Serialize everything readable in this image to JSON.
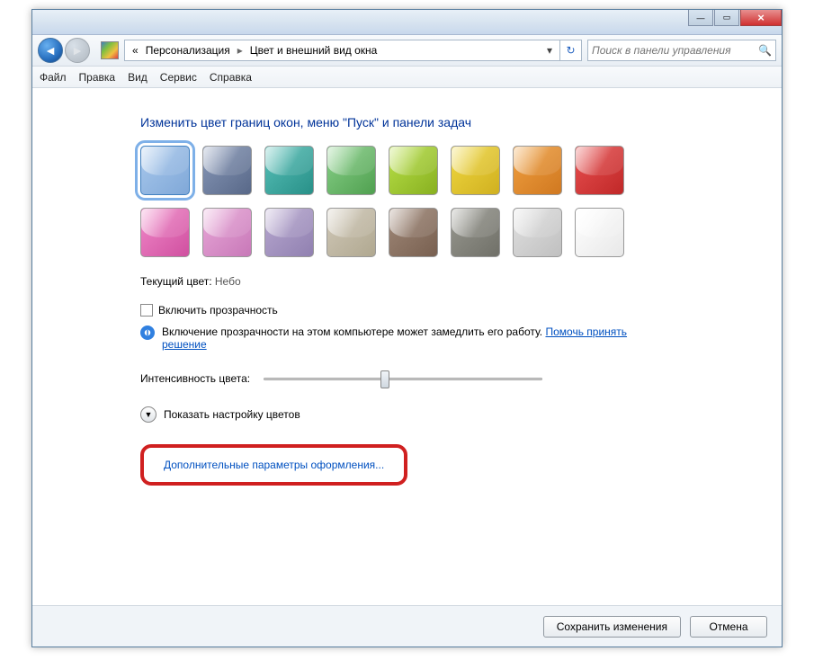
{
  "titlebar": {
    "minimize": "—",
    "maximize": "▭",
    "close": "×"
  },
  "breadcrumb": {
    "prefix": "«",
    "part1": "Персонализация",
    "part2": "Цвет и внешний вид окна"
  },
  "search": {
    "placeholder": "Поиск в панели управления"
  },
  "menu": {
    "file": "Файл",
    "edit": "Правка",
    "view": "Вид",
    "tools": "Сервис",
    "help": "Справка"
  },
  "heading": "Изменить цвет границ окон, меню \"Пуск\" и панели задач",
  "colors": [
    {
      "name": "sky",
      "c1": "#a8c8ec",
      "c2": "#80a8d8",
      "selected": true
    },
    {
      "name": "twilight",
      "c1": "#8898b8",
      "c2": "#586888"
    },
    {
      "name": "sea",
      "c1": "#58c0b8",
      "c2": "#289088"
    },
    {
      "name": "leaf",
      "c1": "#88d088",
      "c2": "#50a050"
    },
    {
      "name": "lime",
      "c1": "#b8e048",
      "c2": "#88b020"
    },
    {
      "name": "sun",
      "c1": "#f0d840",
      "c2": "#d0b020"
    },
    {
      "name": "pumpkin",
      "c1": "#f0a040",
      "c2": "#d07820"
    },
    {
      "name": "ruby",
      "c1": "#e85050",
      "c2": "#c02828"
    },
    {
      "name": "fuchsia",
      "c1": "#f088c8",
      "c2": "#d050a0"
    },
    {
      "name": "violet",
      "c1": "#e8a8d8",
      "c2": "#c878b8"
    },
    {
      "name": "lavender",
      "c1": "#b8a8d0",
      "c2": "#9080b0"
    },
    {
      "name": "taupe",
      "c1": "#d0c8b8",
      "c2": "#b0a890"
    },
    {
      "name": "chocolate",
      "c1": "#a08878",
      "c2": "#786050"
    },
    {
      "name": "slate",
      "c1": "#989890",
      "c2": "#707068"
    },
    {
      "name": "frost",
      "c1": "#e0e0e0",
      "c2": "#c0c0c0"
    },
    {
      "name": "snow",
      "c1": "#ffffff",
      "c2": "#e8e8e8"
    }
  ],
  "current_color": {
    "label": "Текущий цвет:",
    "value": "Небо"
  },
  "transparency": {
    "label": "Включить прозрачность",
    "info": "Включение прозрачности на этом компьютере может замедлить его работу.",
    "help_link": "Помочь принять решение"
  },
  "intensity": {
    "label": "Интенсивность цвета:"
  },
  "expand": {
    "label": "Показать настройку цветов"
  },
  "advanced_link": "Дополнительные параметры оформления...",
  "buttons": {
    "save": "Сохранить изменения",
    "cancel": "Отмена"
  }
}
